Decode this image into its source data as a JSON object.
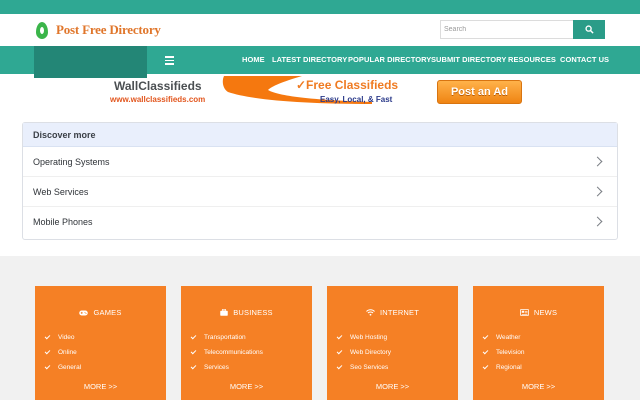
{
  "header": {
    "logo_text": "Post Free Directory",
    "search_placeholder": "Search"
  },
  "nav": {
    "items": [
      "HOME",
      "LATEST DIRECTORY",
      "POPULAR DIRECTORY",
      "SUBMIT DIRECTORY",
      "RESOURCES",
      "CONTACT US"
    ]
  },
  "banner": {
    "brand": "WallClassifieds",
    "url": "www.wallclassifieds.com",
    "headline": "✓Free Classifieds",
    "tagline": "Easy, Local, & Fast",
    "cta": "Post an Ad"
  },
  "discover": {
    "title": "Discover more",
    "items": [
      "Operating Systems",
      "Web Services",
      "Mobile Phones"
    ]
  },
  "categories": [
    {
      "title": "GAMES",
      "icon": "gamepad-icon",
      "items": [
        "Video",
        "Online",
        "General"
      ],
      "more": "MORE >>"
    },
    {
      "title": "BUSINESS",
      "icon": "briefcase-icon",
      "items": [
        "Transportation",
        "Telecommunications",
        "Services"
      ],
      "more": "MORE >>"
    },
    {
      "title": "INTERNET",
      "icon": "wifi-icon",
      "items": [
        "Web Hosting",
        "Web Directory",
        "Seo Services"
      ],
      "more": "MORE >>"
    },
    {
      "title": "NEWS",
      "icon": "newspaper-icon",
      "items": [
        "Weather",
        "Television",
        "Regional"
      ],
      "more": "MORE >>"
    }
  ],
  "colors": {
    "teal": "#2fa893",
    "teal_dark": "#238676",
    "orange": "#f58025",
    "logo_orange": "#e0762b"
  }
}
